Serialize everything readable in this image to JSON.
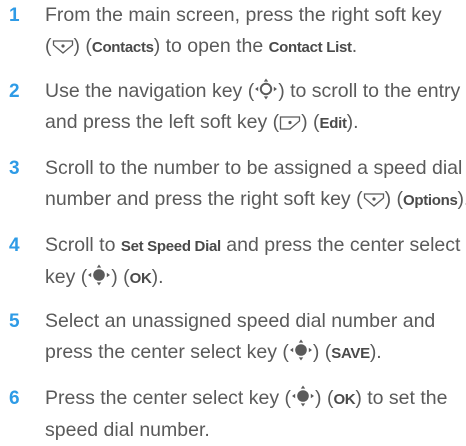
{
  "accent_color": "#2e9be6",
  "text_color": "#5a5a5a",
  "steps": [
    {
      "number": "1",
      "lines": [
        {
          "a": "From the main screen, press the right soft key"
        },
        {
          "a": "(",
          "b": ") (",
          "kw1": "Contacts",
          "c": ") to open the ",
          "kw2": "Contact List",
          "d": "."
        }
      ]
    },
    {
      "number": "2",
      "lines": [
        {
          "a": "Use the navigation key (",
          "b": ") to scroll to the entry"
        },
        {
          "a": "and press the left soft key (",
          "b": ") (",
          "kw1": "Edit",
          "c": ")."
        }
      ]
    },
    {
      "number": "3",
      "lines": [
        {
          "a": "Scroll to the number to be assigned a speed dial"
        },
        {
          "a": "number and press the right soft key (",
          "b": ") (",
          "kw1": "Options",
          "c": ")."
        }
      ]
    },
    {
      "number": "4",
      "lines": [
        {
          "a": "Scroll to ",
          "kw1": "Set Speed Dial",
          "b": " and press the center select"
        },
        {
          "a": "key (",
          "b": ") (",
          "kw1": "OK",
          "c": ")."
        }
      ]
    },
    {
      "number": "5",
      "lines": [
        {
          "a": "Select an unassigned speed dial number and"
        },
        {
          "a": "press the center select key (",
          "b": ") (",
          "kw1": "SAVE",
          "c": ")."
        }
      ]
    },
    {
      "number": "6",
      "lines": [
        {
          "a": "Press the center select key (",
          "b": ") (",
          "kw1": "OK",
          "c": ") to set the"
        },
        {
          "a": "speed dial number."
        }
      ]
    }
  ],
  "icons": {
    "right_soft_key": "right-soft-key-icon",
    "left_soft_key": "left-soft-key-icon",
    "navigation_key": "navigation-key-icon",
    "center_select_key": "center-select-key-icon"
  }
}
